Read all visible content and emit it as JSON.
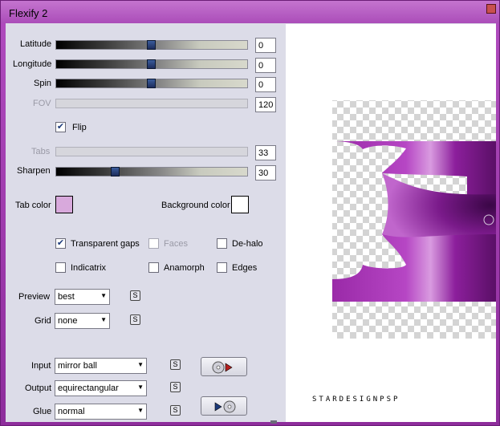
{
  "window": {
    "title": "Flexify 2"
  },
  "sliders": [
    {
      "key": "latitude",
      "label": "Latitude",
      "value": "0",
      "level": 0.5,
      "enabled": true
    },
    {
      "key": "longitude",
      "label": "Longitude",
      "value": "0",
      "level": 0.5,
      "enabled": true
    },
    {
      "key": "spin",
      "label": "Spin",
      "value": "0",
      "level": 0.5,
      "enabled": true
    },
    {
      "key": "fov",
      "label": "FOV",
      "value": "120",
      "enabled": false
    },
    {
      "key": "tabs",
      "label": "Tabs",
      "value": "33",
      "enabled": false
    },
    {
      "key": "sharpen",
      "label": "Sharpen",
      "value": "30",
      "level": 0.3,
      "enabled": true
    }
  ],
  "flip": {
    "label": "Flip",
    "checked": true
  },
  "colors": {
    "tab_color_label": "Tab color",
    "tab_color": "#d8a9dc",
    "background_color_label": "Background color",
    "background_color": "#ffffff"
  },
  "options": {
    "transparent_gaps": {
      "label": "Transparent gaps",
      "checked": true
    },
    "faces": {
      "label": "Faces",
      "checked": false,
      "enabled": false
    },
    "de_halo": {
      "label": "De-halo",
      "checked": false
    },
    "indicatrix": {
      "label": "Indicatrix",
      "checked": false
    },
    "anamorph": {
      "label": "Anamorph",
      "checked": false
    },
    "edges": {
      "label": "Edges",
      "checked": false
    }
  },
  "preview_select": {
    "label": "Preview",
    "value": "best"
  },
  "grid_select": {
    "label": "Grid",
    "value": "none"
  },
  "input_select": {
    "label": "Input",
    "value": "mirror ball"
  },
  "output_select": {
    "label": "Output",
    "value": "equirectangular"
  },
  "glue_select": {
    "label": "Glue",
    "value": "normal"
  },
  "small_button_glyph": "S",
  "preview_panel": {
    "watermark": "STARDESIGNPSP"
  },
  "accent_color": "#9b2fa8"
}
